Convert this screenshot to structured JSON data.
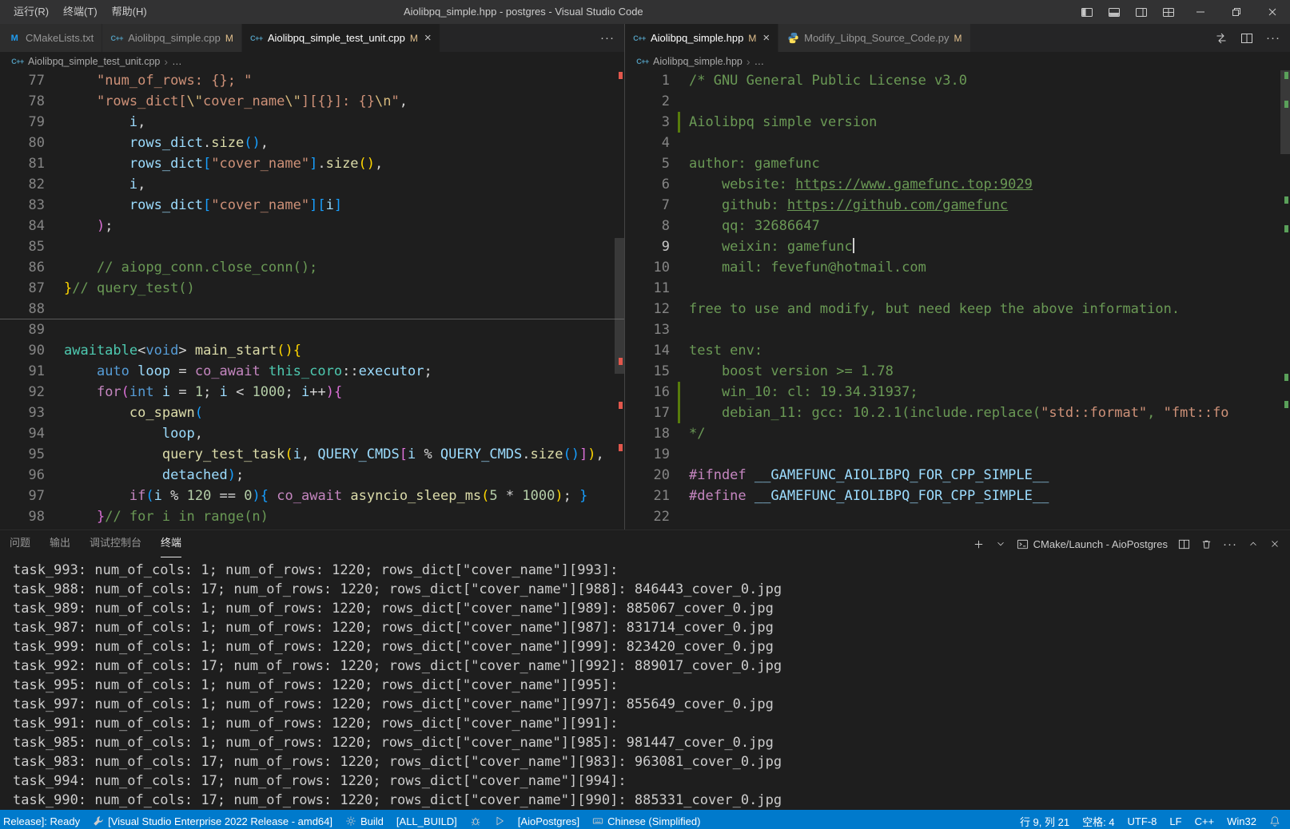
{
  "window": {
    "title": "Aiolibpq_simple.hpp - postgres - Visual Studio Code",
    "menus": [
      "运行(R)",
      "终端(T)",
      "帮助(H)"
    ]
  },
  "icons": {
    "cmake_glyph": "M",
    "cpp_glyph": "C++"
  },
  "colors": {
    "statusbar": "#007acc",
    "modified_badge": "#e2c08d",
    "comment": "#6a9955",
    "string": "#ce9178",
    "keyword": "#569cd6",
    "control": "#c586c0",
    "gutter_change": "#587c0c",
    "overview_red": "#e2574c",
    "overview_green": "#5aa05a"
  },
  "left_group": {
    "tabs": [
      {
        "label": "CMakeLists.txt",
        "badge": ""
      },
      {
        "label": "Aiolibpq_simple.cpp",
        "badge": "M"
      },
      {
        "label": "Aiolibpq_simple_test_unit.cpp",
        "badge": "M"
      }
    ],
    "breadcrumb": {
      "file": "Aiolibpq_simple_test_unit.cpp",
      "more": "…"
    },
    "lines": [
      {
        "n": 77,
        "k": [
          [
            "    ",
            "txt"
          ],
          [
            "\"num_of_rows: {}; \"",
            "str"
          ]
        ]
      },
      {
        "n": 78,
        "k": [
          [
            "    ",
            "txt"
          ],
          [
            "\"rows_dict[",
            "str"
          ],
          [
            "\\\"",
            "esc"
          ],
          [
            "cover_name",
            "str"
          ],
          [
            "\\\"",
            "esc"
          ],
          [
            "][{}]: {}",
            "str"
          ],
          [
            "\\n",
            "esc"
          ],
          [
            "\"",
            "str"
          ],
          [
            ",",
            "txt"
          ]
        ]
      },
      {
        "n": 79,
        "k": [
          [
            "        ",
            "txt"
          ],
          [
            "i",
            "var"
          ],
          [
            ",",
            "txt"
          ]
        ]
      },
      {
        "n": 80,
        "k": [
          [
            "        ",
            "txt"
          ],
          [
            "rows_dict",
            "var"
          ],
          [
            ".",
            "txt"
          ],
          [
            "size",
            "fn"
          ],
          [
            "(",
            "br3"
          ],
          [
            ")",
            "br3"
          ],
          [
            ",",
            "txt"
          ]
        ]
      },
      {
        "n": 81,
        "k": [
          [
            "        ",
            "txt"
          ],
          [
            "rows_dict",
            "var"
          ],
          [
            "[",
            "br3"
          ],
          [
            "\"cover_name\"",
            "str"
          ],
          [
            "]",
            "br3"
          ],
          [
            ".",
            "txt"
          ],
          [
            "size",
            "fn"
          ],
          [
            "(",
            "br1"
          ],
          [
            ")",
            "br1"
          ],
          [
            ",",
            "txt"
          ]
        ]
      },
      {
        "n": 82,
        "k": [
          [
            "        ",
            "txt"
          ],
          [
            "i",
            "var"
          ],
          [
            ",",
            "txt"
          ]
        ]
      },
      {
        "n": 83,
        "k": [
          [
            "        ",
            "txt"
          ],
          [
            "rows_dict",
            "var"
          ],
          [
            "[",
            "br3"
          ],
          [
            "\"cover_name\"",
            "str"
          ],
          [
            "]",
            "br3"
          ],
          [
            "[",
            "br3"
          ],
          [
            "i",
            "var"
          ],
          [
            "]",
            "br3"
          ]
        ]
      },
      {
        "n": 84,
        "k": [
          [
            "    ",
            "txt"
          ],
          [
            ")",
            "br2"
          ],
          [
            ";",
            "txt"
          ]
        ]
      },
      {
        "n": 85,
        "k": []
      },
      {
        "n": 86,
        "k": [
          [
            "    ",
            "txt"
          ],
          [
            "// aiopg_conn.close_conn();",
            "cmt"
          ]
        ]
      },
      {
        "n": 87,
        "k": [
          [
            "}",
            "br1"
          ],
          [
            "// query_test()",
            "cmt"
          ]
        ]
      },
      {
        "n": 88,
        "k": [],
        "hl": true
      },
      {
        "n": 89,
        "k": []
      },
      {
        "n": 90,
        "k": [
          [
            "awaitable",
            "type"
          ],
          [
            "<",
            "txt"
          ],
          [
            "void",
            "kw"
          ],
          [
            ">",
            "txt"
          ],
          [
            " ",
            "txt"
          ],
          [
            "main_start",
            "fn"
          ],
          [
            "(",
            "br1"
          ],
          [
            ")",
            "br1"
          ],
          [
            "{",
            "br1"
          ]
        ]
      },
      {
        "n": 91,
        "k": [
          [
            "    ",
            "txt"
          ],
          [
            "auto",
            "kw"
          ],
          [
            " ",
            "txt"
          ],
          [
            "loop",
            "var"
          ],
          [
            " = ",
            "txt"
          ],
          [
            "co_await",
            "ctrl"
          ],
          [
            " ",
            "txt"
          ],
          [
            "this_coro",
            "type"
          ],
          [
            "::",
            "txt"
          ],
          [
            "executor",
            "var"
          ],
          [
            ";",
            "txt"
          ]
        ]
      },
      {
        "n": 92,
        "k": [
          [
            "    ",
            "txt"
          ],
          [
            "for",
            "ctrl"
          ],
          [
            "(",
            "br2"
          ],
          [
            "int",
            "kw"
          ],
          [
            " ",
            "txt"
          ],
          [
            "i",
            "var"
          ],
          [
            " = ",
            "txt"
          ],
          [
            "1",
            "num"
          ],
          [
            "; ",
            "txt"
          ],
          [
            "i",
            "var"
          ],
          [
            " < ",
            "txt"
          ],
          [
            "1000",
            "num"
          ],
          [
            "; ",
            "txt"
          ],
          [
            "i",
            "var"
          ],
          [
            "++",
            "txt"
          ],
          [
            ")",
            "br2"
          ],
          [
            "{",
            "br2"
          ]
        ]
      },
      {
        "n": 93,
        "k": [
          [
            "        ",
            "txt"
          ],
          [
            "co_spawn",
            "fn"
          ],
          [
            "(",
            "br3"
          ]
        ]
      },
      {
        "n": 94,
        "k": [
          [
            "            ",
            "txt"
          ],
          [
            "loop",
            "var"
          ],
          [
            ",",
            "txt"
          ]
        ]
      },
      {
        "n": 95,
        "k": [
          [
            "            ",
            "txt"
          ],
          [
            "query_test_task",
            "fn"
          ],
          [
            "(",
            "br1"
          ],
          [
            "i",
            "var"
          ],
          [
            ", ",
            "txt"
          ],
          [
            "QUERY_CMDS",
            "var"
          ],
          [
            "[",
            "br2"
          ],
          [
            "i",
            "var"
          ],
          [
            " % ",
            "txt"
          ],
          [
            "QUERY_CMDS",
            "var"
          ],
          [
            ".",
            "txt"
          ],
          [
            "size",
            "fn"
          ],
          [
            "(",
            "br3"
          ],
          [
            ")",
            "br3"
          ],
          [
            "]",
            "br2"
          ],
          [
            ")",
            "br1"
          ],
          [
            ",",
            "txt"
          ]
        ]
      },
      {
        "n": 96,
        "k": [
          [
            "            ",
            "txt"
          ],
          [
            "detached",
            "var"
          ],
          [
            ")",
            "br3"
          ],
          [
            ";",
            "txt"
          ]
        ]
      },
      {
        "n": 97,
        "k": [
          [
            "        ",
            "txt"
          ],
          [
            "if",
            "ctrl"
          ],
          [
            "(",
            "br3"
          ],
          [
            "i",
            "var"
          ],
          [
            " % ",
            "txt"
          ],
          [
            "120",
            "num"
          ],
          [
            " == ",
            "txt"
          ],
          [
            "0",
            "num"
          ],
          [
            ")",
            "br3"
          ],
          [
            "{",
            "br3"
          ],
          [
            " ",
            "txt"
          ],
          [
            "co_await",
            "ctrl"
          ],
          [
            " ",
            "txt"
          ],
          [
            "asyncio_sleep_ms",
            "fn"
          ],
          [
            "(",
            "br1"
          ],
          [
            "5",
            "num"
          ],
          [
            " * ",
            "txt"
          ],
          [
            "1000",
            "num"
          ],
          [
            ")",
            "br1"
          ],
          [
            "; ",
            "txt"
          ],
          [
            "}",
            "br3"
          ]
        ]
      },
      {
        "n": 98,
        "k": [
          [
            "    ",
            "txt"
          ],
          [
            "}",
            "br2"
          ],
          [
            "// for i in range(n)",
            "cmt"
          ]
        ]
      }
    ]
  },
  "right_group": {
    "tabs": [
      {
        "label": "Aiolibpq_simple.hpp",
        "badge": "M"
      },
      {
        "label": "Modify_Libpq_Source_Code.py",
        "badge": "M"
      }
    ],
    "breadcrumb": {
      "file": "Aiolibpq_simple.hpp",
      "more": "…"
    },
    "lines": [
      {
        "n": 1,
        "k": [
          [
            "/* GNU General Public License v3.0",
            "cmt"
          ]
        ]
      },
      {
        "n": 2,
        "k": []
      },
      {
        "n": 3,
        "k": [
          [
            "Aiolibpq simple version",
            "cmt"
          ]
        ],
        "bar": true
      },
      {
        "n": 4,
        "k": []
      },
      {
        "n": 5,
        "k": [
          [
            "author: gamefunc",
            "cmt"
          ]
        ]
      },
      {
        "n": 6,
        "k": [
          [
            "    website: ",
            "cmt"
          ],
          [
            "https://www.gamefunc.top:9029",
            "link"
          ]
        ]
      },
      {
        "n": 7,
        "k": [
          [
            "    github: ",
            "cmt"
          ],
          [
            "https://github.com/gamefunc",
            "link"
          ]
        ]
      },
      {
        "n": 8,
        "k": [
          [
            "    qq: 32686647",
            "cmt"
          ]
        ]
      },
      {
        "n": 9,
        "k": [
          [
            "    weixin: gamefunc",
            "cmt"
          ]
        ],
        "cur": true,
        "act": true
      },
      {
        "n": 10,
        "k": [
          [
            "    mail: fevefun@hotmail.com",
            "cmt"
          ]
        ]
      },
      {
        "n": 11,
        "k": []
      },
      {
        "n": 12,
        "k": [
          [
            "free to use and modify, but need keep the above information.",
            "cmt"
          ]
        ]
      },
      {
        "n": 13,
        "k": []
      },
      {
        "n": 14,
        "k": [
          [
            "test env:",
            "cmt"
          ]
        ]
      },
      {
        "n": 15,
        "k": [
          [
            "    boost version >= 1.78",
            "cmt"
          ]
        ]
      },
      {
        "n": 16,
        "k": [
          [
            "    win_10: cl: 19.34.31937;",
            "cmt"
          ]
        ],
        "bar": true
      },
      {
        "n": 17,
        "k": [
          [
            "    debian_11: gcc: 10.2.1(include.replace(",
            "cmt"
          ],
          [
            "\"std::format\"",
            "str"
          ],
          [
            ", ",
            "cmt"
          ],
          [
            "\"fmt::fo",
            "str"
          ]
        ],
        "bar": true
      },
      {
        "n": 18,
        "k": [
          [
            "*/",
            "cmt"
          ]
        ]
      },
      {
        "n": 19,
        "k": []
      },
      {
        "n": 20,
        "k": [
          [
            "#ifndef",
            "pp"
          ],
          [
            " ",
            "txt"
          ],
          [
            "__GAMEFUNC_AIOLIBPQ_FOR_CPP_SIMPLE__",
            "macro"
          ]
        ]
      },
      {
        "n": 21,
        "k": [
          [
            "#define",
            "pp"
          ],
          [
            " ",
            "txt"
          ],
          [
            "__GAMEFUNC_AIOLIBPQ_FOR_CPP_SIMPLE__",
            "macro"
          ]
        ]
      },
      {
        "n": 22,
        "k": []
      }
    ]
  },
  "panel": {
    "tabs": [
      "问题",
      "输出",
      "调试控制台",
      "终端"
    ],
    "active_tab": "终端",
    "terminal_label": "CMake/Launch - AioPostgres",
    "terminal_lines": [
      "task_993: num_of_cols: 1; num_of_rows: 1220; rows_dict[\"cover_name\"][993]:",
      "task_988: num_of_cols: 17; num_of_rows: 1220; rows_dict[\"cover_name\"][988]: 846443_cover_0.jpg",
      "task_989: num_of_cols: 1; num_of_rows: 1220; rows_dict[\"cover_name\"][989]: 885067_cover_0.jpg",
      "task_987: num_of_cols: 1; num_of_rows: 1220; rows_dict[\"cover_name\"][987]: 831714_cover_0.jpg",
      "task_999: num_of_cols: 1; num_of_rows: 1220; rows_dict[\"cover_name\"][999]: 823420_cover_0.jpg",
      "task_992: num_of_cols: 17; num_of_rows: 1220; rows_dict[\"cover_name\"][992]: 889017_cover_0.jpg",
      "task_995: num_of_cols: 1; num_of_rows: 1220; rows_dict[\"cover_name\"][995]:",
      "task_997: num_of_cols: 1; num_of_rows: 1220; rows_dict[\"cover_name\"][997]: 855649_cover_0.jpg",
      "task_991: num_of_cols: 1; num_of_rows: 1220; rows_dict[\"cover_name\"][991]:",
      "task_985: num_of_cols: 1; num_of_rows: 1220; rows_dict[\"cover_name\"][985]: 981447_cover_0.jpg",
      "task_983: num_of_cols: 17; num_of_rows: 1220; rows_dict[\"cover_name\"][983]: 963081_cover_0.jpg",
      "task_994: num_of_cols: 17; num_of_rows: 1220; rows_dict[\"cover_name\"][994]:",
      "task_990: num_of_cols: 17; num_of_rows: 1220; rows_dict[\"cover_name\"][990]: 885331_cover_0.jpg"
    ]
  },
  "statusbar": {
    "cmake_status": "Release]: Ready",
    "kit": "[Visual Studio Enterprise 2022 Release - amd64]",
    "build_label": "Build",
    "build_target": "[ALL_BUILD]",
    "launch_target": "[AioPostgres]",
    "ime": "Chinese (Simplified)",
    "cursor_position": "行 9, 列 21",
    "indentation": "空格: 4",
    "encoding": "UTF-8",
    "eol": "LF",
    "language": "C++",
    "platform": "Win32"
  }
}
